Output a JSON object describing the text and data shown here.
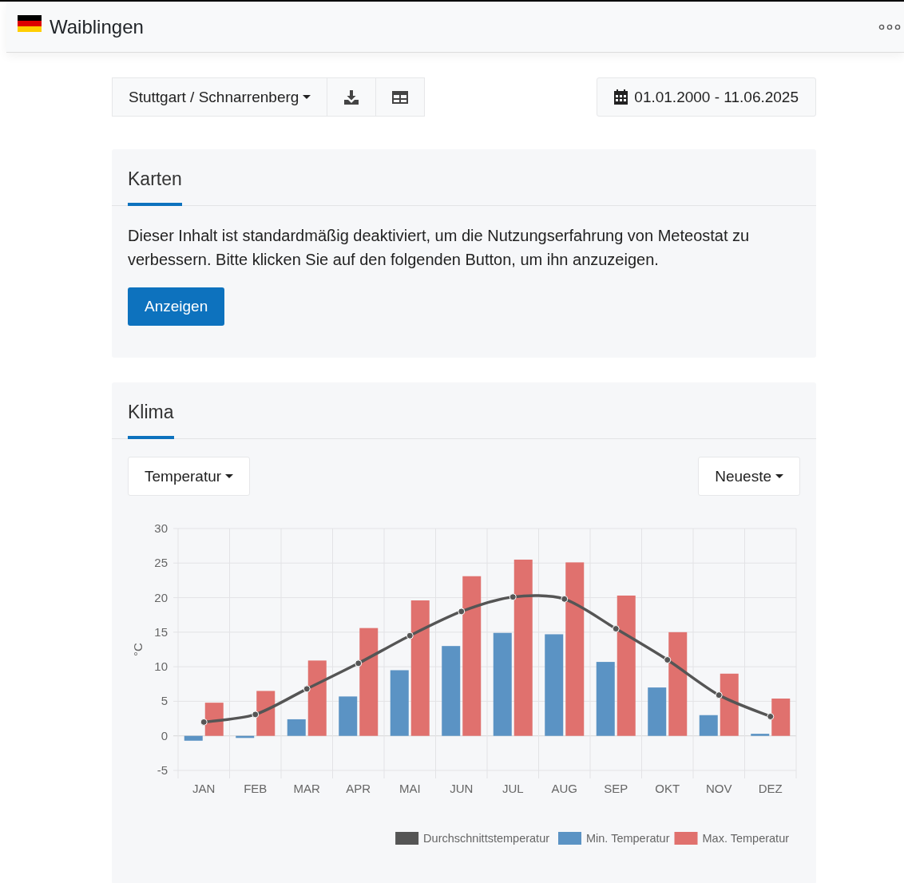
{
  "header": {
    "title": "Waiblingen"
  },
  "toolbar": {
    "station": "Stuttgart / Schnarrenberg",
    "date_range": "01.01.2000 - 11.06.2025"
  },
  "maps_card": {
    "tabs": [
      {
        "label": "Karten",
        "selected": true
      }
    ],
    "text": "Dieser Inhalt ist standardmäßig deaktiviert, um die Nutzungserfahrung von Meteostat zu verbessern. Bitte klicken Sie auf den folgenden Button, um ihn anzuzeigen.",
    "button": "Anzeigen"
  },
  "climate_card": {
    "tabs": [
      {
        "label": "Klima",
        "selected": true
      }
    ],
    "parameter_dropdown": "Temperatur",
    "period_dropdown": "Neueste",
    "chart_data": {
      "type": "bar",
      "ylabel": "°C",
      "categories": [
        "JAN",
        "FEB",
        "MAR",
        "APR",
        "MAI",
        "JUN",
        "JUL",
        "AUG",
        "SEP",
        "OKT",
        "NOV",
        "DEZ"
      ],
      "ylim": [
        -5,
        30
      ],
      "yticks": [
        -5,
        0,
        5,
        10,
        15,
        20,
        25,
        30
      ],
      "grid": true,
      "legend": "bottom-right",
      "series": [
        {
          "name": "Durchschnittstemperatur",
          "type": "line",
          "marker": "circle",
          "color": "#555555",
          "values": [
            2.0,
            3.1,
            6.8,
            10.5,
            14.5,
            18.0,
            20.1,
            19.8,
            15.5,
            11.0,
            5.9,
            2.8
          ]
        },
        {
          "name": "Min. Temperatur",
          "color": "#5b93c4",
          "values": [
            -0.7,
            -0.3,
            2.4,
            5.7,
            9.5,
            13.0,
            14.9,
            14.7,
            10.7,
            7.0,
            3.0,
            0.3
          ]
        },
        {
          "name": "Max. Temperatur",
          "color": "#e0716e",
          "values": [
            4.8,
            6.5,
            10.9,
            15.6,
            19.6,
            23.1,
            25.5,
            25.1,
            20.3,
            15.0,
            9.0,
            5.4
          ]
        }
      ]
    }
  }
}
